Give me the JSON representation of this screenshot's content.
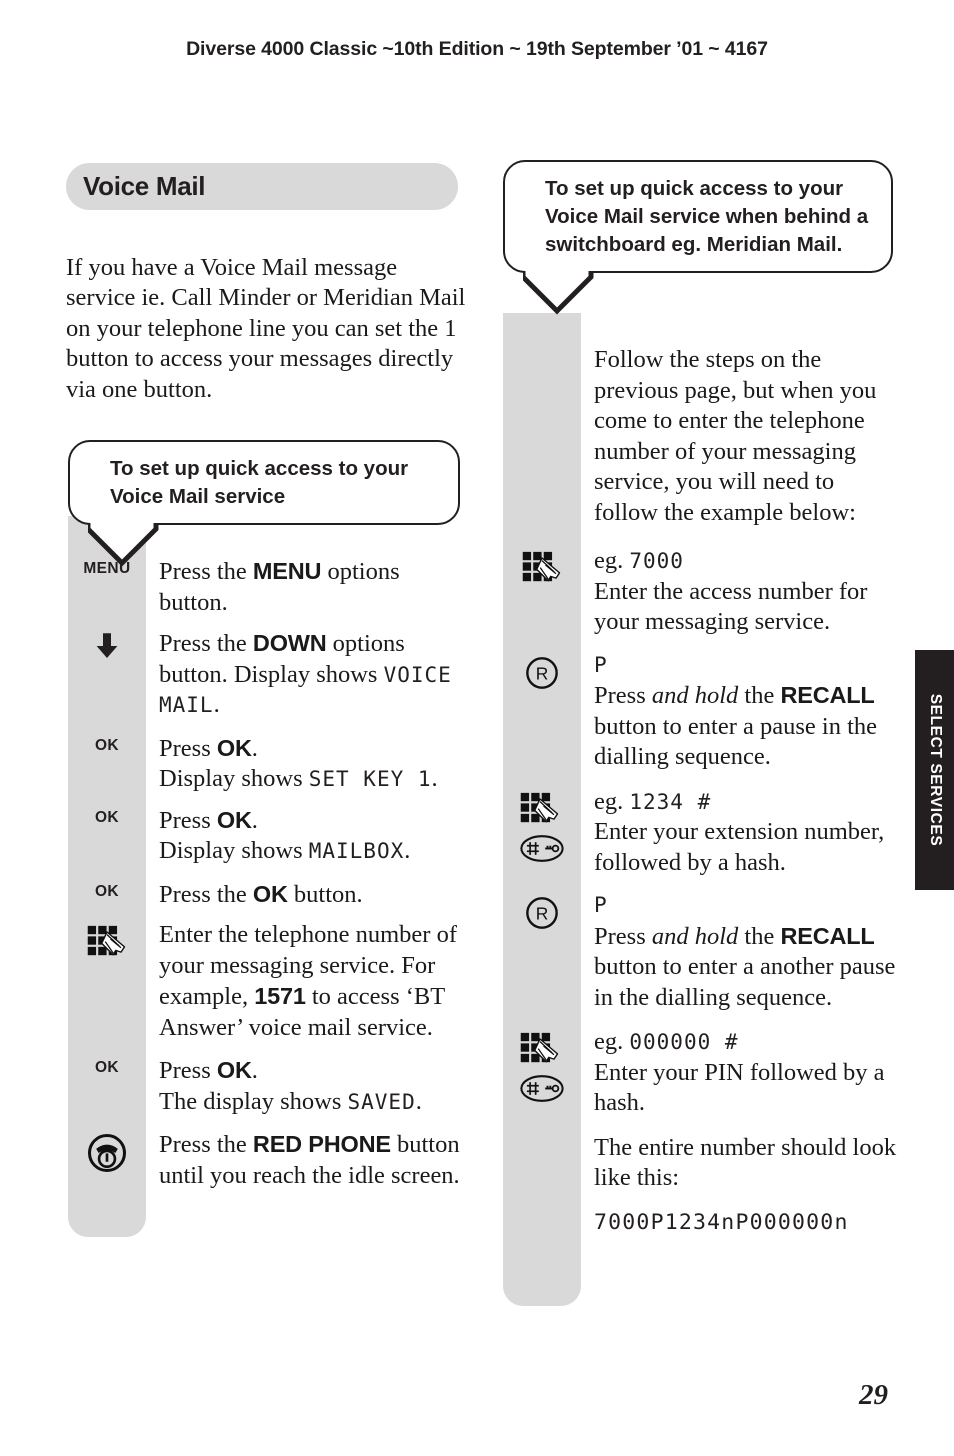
{
  "running_header": "Diverse 4000 Classic ~10th Edition ~ 19th September ’01 ~ 4167",
  "page_number": "29",
  "thumb_tab": {
    "label": "SELECT SERVICES"
  },
  "section": {
    "title": "Voice Mail",
    "intro": "If you have a Voice Mail message service ie. Call Minder or Meridian Mail on your telephone line you can set the 1 button to access your messages directly via one button."
  },
  "left_column": {
    "bubble": "To set up quick access to your Voice Mail service",
    "steps": [
      {
        "icon": "menu-key-label",
        "icon_label": "MENU",
        "text_parts": [
          {
            "type": "plain",
            "text": "Press the "
          },
          {
            "type": "bold",
            "text": "MENU"
          },
          {
            "type": "plain",
            "text": " options button."
          }
        ]
      },
      {
        "icon": "down-arrow-icon",
        "text_parts": [
          {
            "type": "plain",
            "text": "Press the "
          },
          {
            "type": "bold",
            "text": "DOWN"
          },
          {
            "type": "plain",
            "text": " options button. Display shows "
          },
          {
            "type": "lcd",
            "text": "VOICE MAIL"
          },
          {
            "type": "plain",
            "text": "."
          }
        ]
      },
      {
        "icon": "ok-key-label",
        "icon_label": "OK",
        "text_parts": [
          {
            "type": "plain",
            "text": "Press "
          },
          {
            "type": "bold",
            "text": "OK"
          },
          {
            "type": "plain",
            "text": "."
          },
          {
            "type": "break"
          },
          {
            "type": "plain",
            "text": "Display shows "
          },
          {
            "type": "lcd",
            "text": "SET KEY 1"
          },
          {
            "type": "plain",
            "text": "."
          }
        ]
      },
      {
        "icon": "ok-key-label",
        "icon_label": "OK",
        "text_parts": [
          {
            "type": "plain",
            "text": "Press "
          },
          {
            "type": "bold",
            "text": "OK"
          },
          {
            "type": "plain",
            "text": "."
          },
          {
            "type": "break"
          },
          {
            "type": "plain",
            "text": "Display shows "
          },
          {
            "type": "lcd",
            "text": "MAILBOX"
          },
          {
            "type": "plain",
            "text": "."
          }
        ]
      },
      {
        "icon": "ok-key-label",
        "icon_label": "OK",
        "text_parts": [
          {
            "type": "plain",
            "text": "Press the "
          },
          {
            "type": "bold",
            "text": "OK"
          },
          {
            "type": "plain",
            "text": " button."
          }
        ]
      },
      {
        "icon": "keypad-icon",
        "text_parts": [
          {
            "type": "plain",
            "text": "Enter the telephone number of your messaging service. For example, "
          },
          {
            "type": "bold",
            "text": "1571"
          },
          {
            "type": "plain",
            "text": " to access ‘BT Answer’ voice mail service."
          }
        ]
      },
      {
        "icon": "ok-key-label",
        "icon_label": "OK",
        "text_parts": [
          {
            "type": "plain",
            "text": "Press "
          },
          {
            "type": "bold",
            "text": "OK"
          },
          {
            "type": "plain",
            "text": "."
          },
          {
            "type": "break"
          },
          {
            "type": "plain",
            "text": "The display shows "
          },
          {
            "type": "lcd",
            "text": "SAVED"
          },
          {
            "type": "plain",
            "text": "."
          }
        ]
      },
      {
        "icon": "red-phone-icon",
        "text_parts": [
          {
            "type": "plain",
            "text": "Press the "
          },
          {
            "type": "bold",
            "text": "RED PHONE"
          },
          {
            "type": "plain",
            "text": " button until you reach the idle screen."
          }
        ]
      }
    ]
  },
  "right_column": {
    "bubble": "To set up quick access to your Voice Mail service when behind a switchboard eg. Meridian Mail.",
    "steps": [
      {
        "icon": "none",
        "text_parts": [
          {
            "type": "plain",
            "text": "Follow the steps on the previous page, but when you come to enter the telephone number of your messaging service, you will need to follow the example below:"
          }
        ]
      },
      {
        "icon": "keypad-icon",
        "eg_prefix": "eg. ",
        "eg_lcd": "7000",
        "text_parts": [
          {
            "type": "plain",
            "text": "Enter the access number for your messaging service."
          }
        ]
      },
      {
        "icon": "recall-icon",
        "eg_lcd": "P",
        "text_parts": [
          {
            "type": "plain",
            "text": "Press "
          },
          {
            "type": "italic",
            "text": "and hold"
          },
          {
            "type": "plain",
            "text": " the "
          },
          {
            "type": "bold",
            "text": "RECALL"
          },
          {
            "type": "plain",
            "text": " button to enter a pause in the dialling sequence."
          }
        ]
      },
      {
        "icon": "keypad-and-hash-icon",
        "eg_prefix": "eg. ",
        "eg_lcd": "1234 #",
        "text_parts": [
          {
            "type": "plain",
            "text": "Enter your extension number, followed by a hash."
          }
        ]
      },
      {
        "icon": "recall-icon",
        "eg_lcd": "P",
        "text_parts": [
          {
            "type": "plain",
            "text": "Press "
          },
          {
            "type": "italic",
            "text": "and hold"
          },
          {
            "type": "plain",
            "text": " the "
          },
          {
            "type": "bold",
            "text": "RECALL"
          },
          {
            "type": "plain",
            "text": " button to enter a another pause in the dialling sequence."
          }
        ]
      },
      {
        "icon": "keypad-and-hash-icon",
        "eg_prefix": "eg. ",
        "eg_lcd": "000000 #",
        "text_parts": [
          {
            "type": "plain",
            "text": "Enter your PIN followed by a hash."
          }
        ]
      },
      {
        "icon": "none",
        "text_parts": [
          {
            "type": "plain",
            "text": "The entire number should look like this:"
          }
        ]
      },
      {
        "icon": "none",
        "lcd_line": "7000P1234nP000000n"
      }
    ]
  },
  "colors": {
    "gray_strip": "#d9d9d9",
    "ink": "#231f20",
    "tab_background": "#231f20",
    "tab_text": "#ffffff"
  }
}
